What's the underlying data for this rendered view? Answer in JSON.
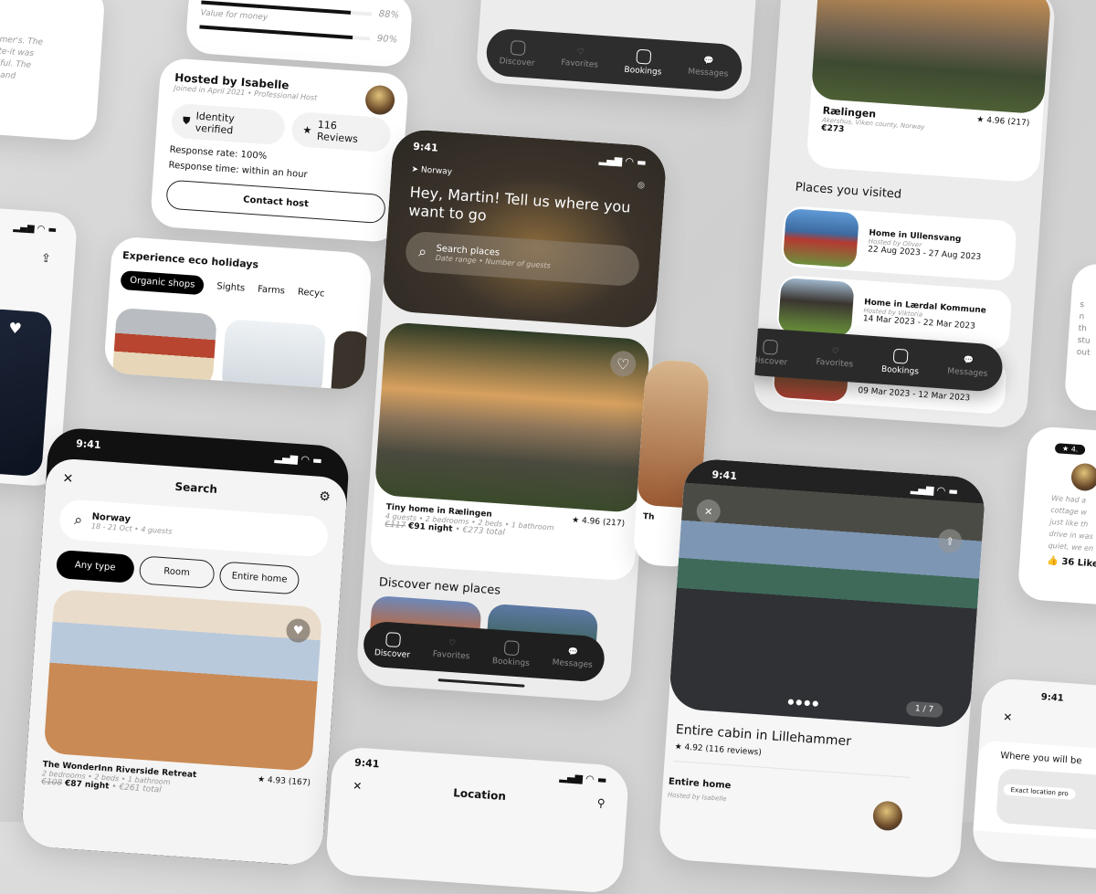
{
  "review_text": {
    "lines": [
      "Lillehammer's. The",
      "nd remote-it was",
      "re beautiful. The",
      "peaceful and"
    ]
  },
  "ratings": {
    "items": [
      {
        "label": "",
        "value": "88%",
        "fill": 0.88
      },
      {
        "label": "Value for money",
        "value": "90%",
        "fill": 0.9
      }
    ]
  },
  "host": {
    "title": "Hosted by Isabelle",
    "subtitle": "Joined in April 2021 • Professional Host",
    "badge_verified": "Identity verified",
    "badge_reviews": "116 Reviews",
    "response_rate": "Response rate: 100%",
    "response_time": "Response time: within an hour",
    "contact_button": "Contact host"
  },
  "eco": {
    "title": "Experience eco holidays",
    "tabs": [
      "Organic shops",
      "Sights",
      "Farms",
      "Recyc"
    ]
  },
  "nav": {
    "items": [
      {
        "label": "Discover",
        "icon": "compass-icon"
      },
      {
        "label": "Favorites",
        "icon": "heart-icon"
      },
      {
        "label": "Bookings",
        "icon": "bookings-icon"
      },
      {
        "label": "Messages",
        "icon": "messages-icon"
      }
    ]
  },
  "status": {
    "time": "9:41"
  },
  "home": {
    "location": "Norway",
    "greeting": "Hey, Martin! Tell us where you want to go",
    "search_title": "Search places",
    "search_sub": "Date range • Number of guests",
    "listing_title": "Tiny home in Rælingen",
    "listing_rating": "4.96 (217)",
    "listing_meta": "4 guests • 2 bedrooms • 2 beds • 1 bathroom",
    "listing_old_price": "€117",
    "listing_price": "€91 night",
    "listing_total": "• €273 total",
    "discover_title": "Discover new places"
  },
  "search": {
    "title": "Search",
    "query": "Norway",
    "query_sub": "18 - 21 Oct • 4 guests",
    "filters": [
      "Any type",
      "Room",
      "Entire home"
    ],
    "listing_title": "The WonderInn Riverside Retreat",
    "listing_rating": "4.93 (167)",
    "listing_meta": "2 bedrooms • 2 beds • 1 bathroom",
    "listing_old_price": "€108",
    "listing_price": "€87 night",
    "listing_total": "• €261 total"
  },
  "location": {
    "title": "Location"
  },
  "partial_listing": {
    "title": "Th"
  },
  "bookings": {
    "listing_title": "Rælingen",
    "listing_location": "Akershus, Viken county, Norway",
    "listing_price": "€273",
    "listing_rating": "4.96 (217)",
    "visited_title": "Places you visited",
    "visited": [
      {
        "title": "Home in Ullensvang",
        "host": "Hosted by Oliver",
        "dates": "22 Aug 2023 - 27 Aug 2023"
      },
      {
        "title": "Home in Lærdal Kommune",
        "host": "Hosted by Viktoria",
        "dates": "14 Mar 2023 - 22 Mar 2023"
      },
      {
        "title": "",
        "host": "",
        "dates": "09 Mar 2023 - 12 Mar 2023"
      }
    ]
  },
  "cabin": {
    "title": "Entire cabin in Lillehammer",
    "rating": "4.92 (116 reviews)",
    "counter": "1 / 7",
    "section": "Entire home",
    "host": "Hosted by Isabelle"
  },
  "right_reviews": {
    "rating": "4.",
    "text": [
      "We had a",
      "cottage w",
      "just like th",
      "drive in was",
      "quiet, we en"
    ],
    "likes": "36 Like",
    "top_text": [
      "s",
      "n",
      "th",
      "stu",
      "out"
    ]
  },
  "where": {
    "title": "Where you will be",
    "map_label": "Exact location pro"
  }
}
